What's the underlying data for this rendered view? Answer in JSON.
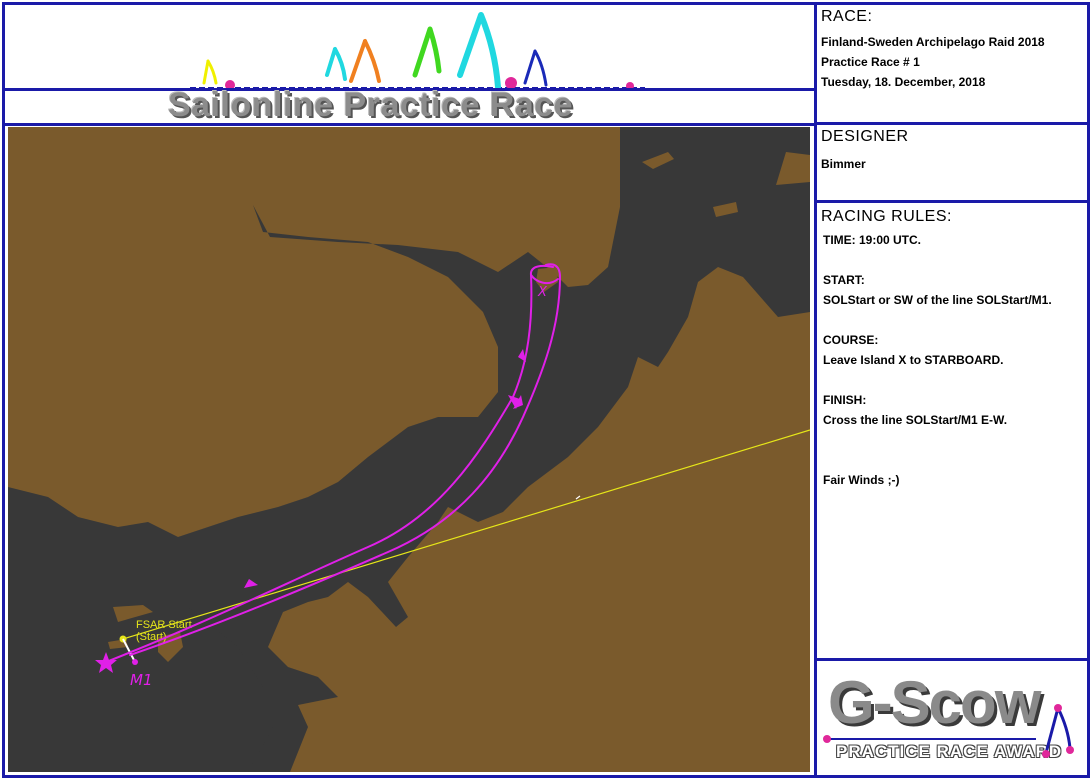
{
  "banner": {
    "title": "Sailonline Practice Race"
  },
  "race": {
    "header": "RACE:",
    "line1": "Finland-Sweden Archipelago Raid 2018",
    "line2": "Practice Race # 1",
    "line3": "Tuesday, 18. December, 2018"
  },
  "designer": {
    "header": "DESIGNER",
    "name": "Bimmer"
  },
  "rules": {
    "header": "RACING RULES:",
    "time": "TIME:  19:00 UTC.",
    "start_label": "START:",
    "start_text": "SOLStart or SW of the line SOLStart/M1.",
    "course_label": "COURSE:",
    "course_text": "Leave Island X to STARBOARD.",
    "finish_label": "FINISH:",
    "finish_text": "Cross the line SOLStart/M1 E-W.",
    "closing": "Fair Winds ;-)"
  },
  "map": {
    "start_label_1": "FSAR Start",
    "start_label_2": "(Start)",
    "mark_m1": "M1",
    "island_x": "X",
    "colors": {
      "land": "#7a5a2c",
      "water": "#383838",
      "route": "#e020e8",
      "start_line": "#e6e619"
    }
  },
  "award": {
    "title": "G-Scow",
    "subtitle": "PRACTICE RACE AWARD"
  }
}
